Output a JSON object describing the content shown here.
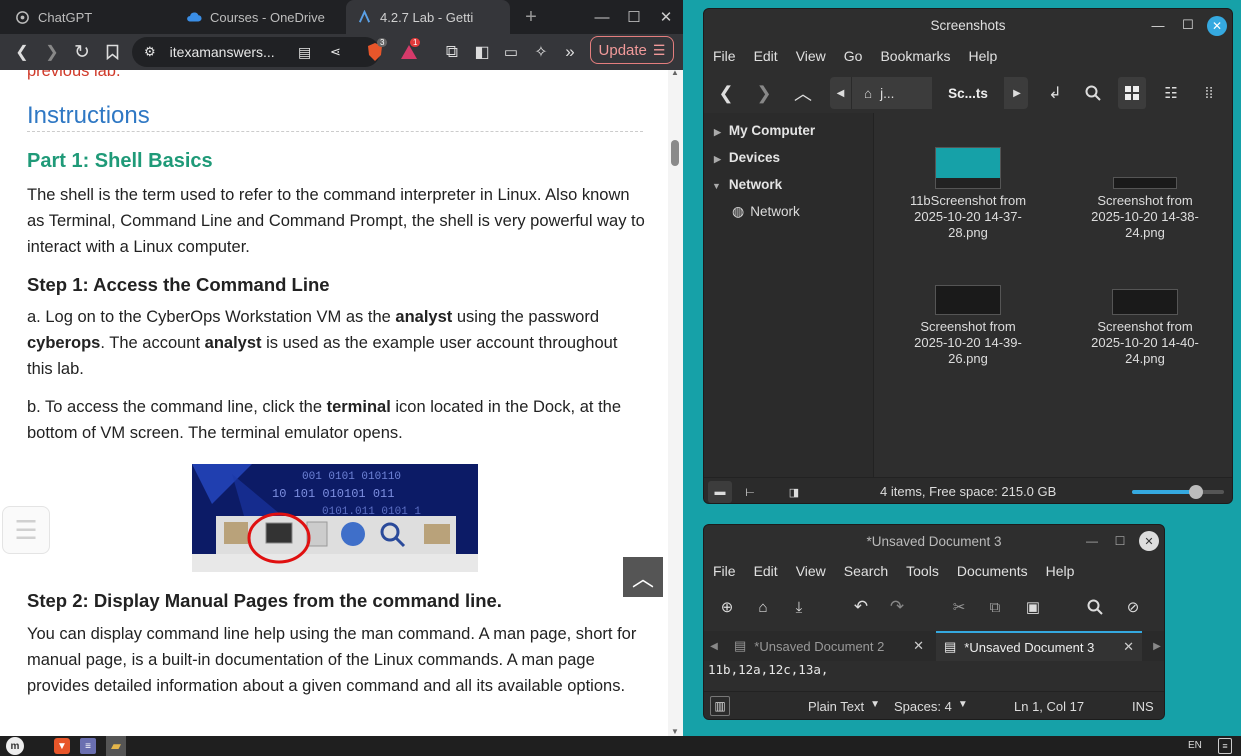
{
  "browser": {
    "tabs": [
      {
        "label": "ChatGPT"
      },
      {
        "label": "Courses - OneDrive"
      },
      {
        "label": "4.2.7 Lab - Getti"
      }
    ],
    "url": "itexamanswers...",
    "shield_badge": "3",
    "alert_badge": "1",
    "update_label": "Update"
  },
  "article": {
    "prev_text": "previous lab.",
    "instructions_heading": "Instructions",
    "part1_heading": "Part 1: Shell Basics",
    "part1_text": "The shell is the term used to refer to the command interpreter in Linux. Also known as Terminal, Command Line and Command Prompt, the shell is very powerful way to interact with a Linux computer.",
    "step1_heading": "Step 1: Access the Command Line",
    "step1a": {
      "p1": "a. Log on to the CyberOps Workstation VM as the ",
      "b1": "analyst",
      "p2": " using the password ",
      "b2": "cyberops",
      "p3": ". The account ",
      "b3": "analyst",
      "p4": " is used as the example user account throughout this lab."
    },
    "step1b": {
      "p1": "b. To access the command line, click the ",
      "b1": "terminal",
      "p2": " icon located in the Dock, at the bottom of VM screen. The terminal emulator opens."
    },
    "step2_heading": "Step 2: Display Manual Pages from the command line.",
    "step2_text": "You can display command line help using the man command. A man page, short for manual page, is a built-in documentation of the Linux commands. A man page provides detailed information about a given command and all its available options."
  },
  "file_manager": {
    "title": "Screenshots",
    "menu": [
      "File",
      "Edit",
      "View",
      "Go",
      "Bookmarks",
      "Help"
    ],
    "breadcrumb": [
      "j...",
      "Sc...ts"
    ],
    "sidebar": {
      "sections": [
        "My Computer",
        "Devices",
        "Network"
      ],
      "network_item": "Network"
    },
    "files": [
      {
        "name": "11bScreenshot from 2025-10-20 14-37-28.png"
      },
      {
        "name": "Screenshot from 2025-10-20 14-38-24.png"
      },
      {
        "name": "Screenshot from 2025-10-20 14-39-26.png"
      },
      {
        "name": "Screenshot from 2025-10-20 14-40-24.png"
      }
    ],
    "status": "4 items, Free space: 215.0 GB",
    "zoom_level": 0.7
  },
  "editor": {
    "title": "*Unsaved Document 3",
    "menu": [
      "File",
      "Edit",
      "View",
      "Search",
      "Tools",
      "Documents",
      "Help"
    ],
    "tabs": [
      {
        "label": "*Unsaved Document 2"
      },
      {
        "label": "*Unsaved Document 3"
      }
    ],
    "content": "11b,12a,12c,13a,",
    "status": {
      "language": "Plain Text",
      "spaces": "Spaces: 4",
      "position": "Ln 1, Col 17",
      "mode": "INS"
    }
  },
  "taskbar": {
    "keyboard": "EN"
  },
  "colors": {
    "desktop": "#16a1a8",
    "accent": "#35a9e0",
    "heading_blue": "#2f78c4",
    "heading_green": "#1f9a78"
  }
}
